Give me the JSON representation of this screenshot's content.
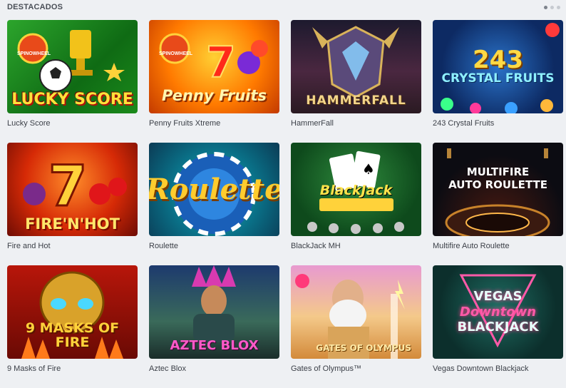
{
  "section": {
    "title": "DESTACADOS",
    "pager_dots": 3,
    "pager_active": 0
  },
  "games": [
    {
      "name": "Lucky Score",
      "logo": "LUCKY SCORE",
      "theme": "soccer-trophy",
      "badge": "SPINOWHEEL"
    },
    {
      "name": "Penny Fruits Xtreme",
      "logo": "Penny Fruits",
      "theme": "fruits-seven",
      "badge": "SPINOWHEEL"
    },
    {
      "name": "HammerFall",
      "logo": "HAMMERFALL",
      "theme": "viking-helmet"
    },
    {
      "name": "243 Crystal Fruits",
      "logo": "243",
      "logo_sub": "CRYSTAL FRUITS",
      "theme": "crystal-fruits"
    },
    {
      "name": "Fire and Hot",
      "logo": "FIRE'N'HOT",
      "theme": "seven-fruits"
    },
    {
      "name": "Roulette",
      "logo": "Roulette",
      "theme": "casino-chip"
    },
    {
      "name": "BlackJack MH",
      "logo": "BlackJack",
      "theme": "playing-cards"
    },
    {
      "name": "Multifire Auto Roulette",
      "logo": "MULTIFIRE",
      "logo_sub": "AUTO ROULETTE",
      "theme": "roulette-wheel"
    },
    {
      "name": "9 Masks of Fire",
      "logo": "9 MASKS OF FIRE",
      "theme": "golden-mask"
    },
    {
      "name": "Aztec Blox",
      "logo": "AZTEC BLOX",
      "theme": "aztec-queen"
    },
    {
      "name": "Gates of Olympus™",
      "logo": "GATES OF OLYMPUS",
      "theme": "zeus"
    },
    {
      "name": "Vegas Downtown Blackjack",
      "logo": "VEGAS",
      "logo_sub": "Downtown",
      "logo_sub2": "BLACKJACK",
      "theme": "neon-sign"
    }
  ]
}
